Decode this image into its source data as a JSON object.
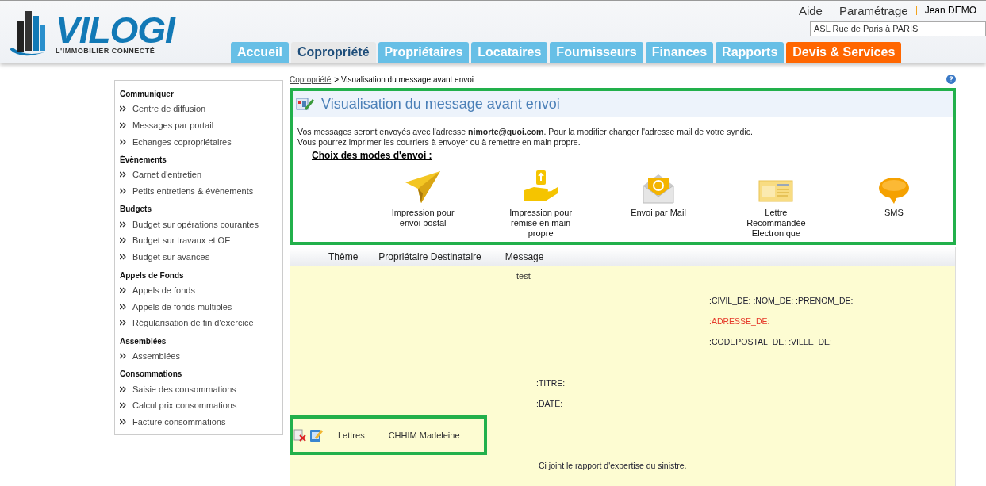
{
  "header": {
    "logo": {
      "title": "VILOGI",
      "tagline": "L'IMMOBILIER CONNECTÉ"
    },
    "top_links": [
      {
        "label": "Aide",
        "kind": "link"
      },
      {
        "label": "Paramétrage",
        "kind": "link"
      },
      {
        "label": "Jean DEMO",
        "kind": "user"
      }
    ],
    "site_field": {
      "value": "ASL Rue de Paris à PARIS"
    },
    "tabs": [
      {
        "label": "Accueil",
        "selected": false,
        "kind": "normal"
      },
      {
        "label": "Copropriété",
        "selected": true,
        "kind": "normal"
      },
      {
        "label": "Propriétaires",
        "selected": false,
        "kind": "normal"
      },
      {
        "label": "Locataires",
        "selected": false,
        "kind": "normal"
      },
      {
        "label": "Fournisseurs",
        "selected": false,
        "kind": "normal"
      },
      {
        "label": "Finances",
        "selected": false,
        "kind": "normal"
      },
      {
        "label": "Rapports",
        "selected": false,
        "kind": "normal"
      },
      {
        "label": "Devis & Services",
        "selected": false,
        "kind": "promo"
      }
    ]
  },
  "sidebar": {
    "sections": [
      {
        "title": "Communiquer",
        "items": [
          "Centre de diffusion",
          "Messages par portail",
          "Echanges copropriétaires"
        ]
      },
      {
        "title": "Évènements",
        "items": [
          "Carnet d'entretien",
          "Petits entretiens & évènements"
        ]
      },
      {
        "title": "Budgets",
        "items": [
          "Budget sur opérations courantes",
          "Budget sur travaux et OE",
          "Budget sur avances"
        ]
      },
      {
        "title": "Appels de Fonds",
        "items": [
          "Appels de fonds",
          "Appels de fonds multiples",
          "Régularisation de fin d'exercice"
        ]
      },
      {
        "title": "Assemblées",
        "items": [
          "Assemblées"
        ]
      },
      {
        "title": "Consommations",
        "items": [
          "Saisie des consommations",
          "Calcul prix consommations",
          "Facture consommations"
        ]
      }
    ]
  },
  "breadcrumb": {
    "link": "Copropriété",
    "current": "> Visualisation du message avant envoi"
  },
  "panel": {
    "title": "Visualisation du message avant envoi",
    "highlighted": true,
    "info": [
      {
        "text": "Vos messages seront envoyés avec l'adresse **nimorte@quoi.com**. Pour la modifier changer l'adresse mail de",
        "link": "votre syndic",
        "after": "."
      },
      {
        "text": "Vous pourrez imprimer les courriers à envoyer ou à remettre en main propre."
      }
    ],
    "modes_heading": "Choix des modes d'envoi :",
    "modes": [
      {
        "kind": "plane",
        "label": "Impression pour envoi postal"
      },
      {
        "kind": "hand",
        "label": "Impression pour remise en main propre"
      },
      {
        "kind": "mail",
        "label": "Envoi par Mail"
      },
      {
        "kind": "letter",
        "label": "Lettre Recommandée Electronique"
      },
      {
        "kind": "sms",
        "label": "SMS"
      }
    ]
  },
  "table": {
    "columns": [
      "Thème",
      "Propriétaire Destinataire",
      "Message"
    ],
    "rows": [
      {
        "highlighted": true,
        "theme": "Lettres",
        "recipient": "CHHIM Madeleine",
        "message": {
          "subject": "test",
          "lines": [
            {
              "kind": "address",
              "text": ":CIVIL_DE: :NOM_DE: :PRENOM_DE:"
            },
            {
              "kind": "address-error",
              "text": ":ADRESSE_DE:"
            },
            {
              "kind": "address",
              "text": ":CODEPOSTAL_DE: :VILLE_DE:"
            },
            {
              "kind": "field",
              "text": ":TITRE:"
            },
            {
              "kind": "field",
              "text": ":DATE:"
            },
            {
              "kind": "body",
              "text": "Ci joint le rapport d'expertise du sinistre."
            }
          ]
        }
      }
    ]
  }
}
